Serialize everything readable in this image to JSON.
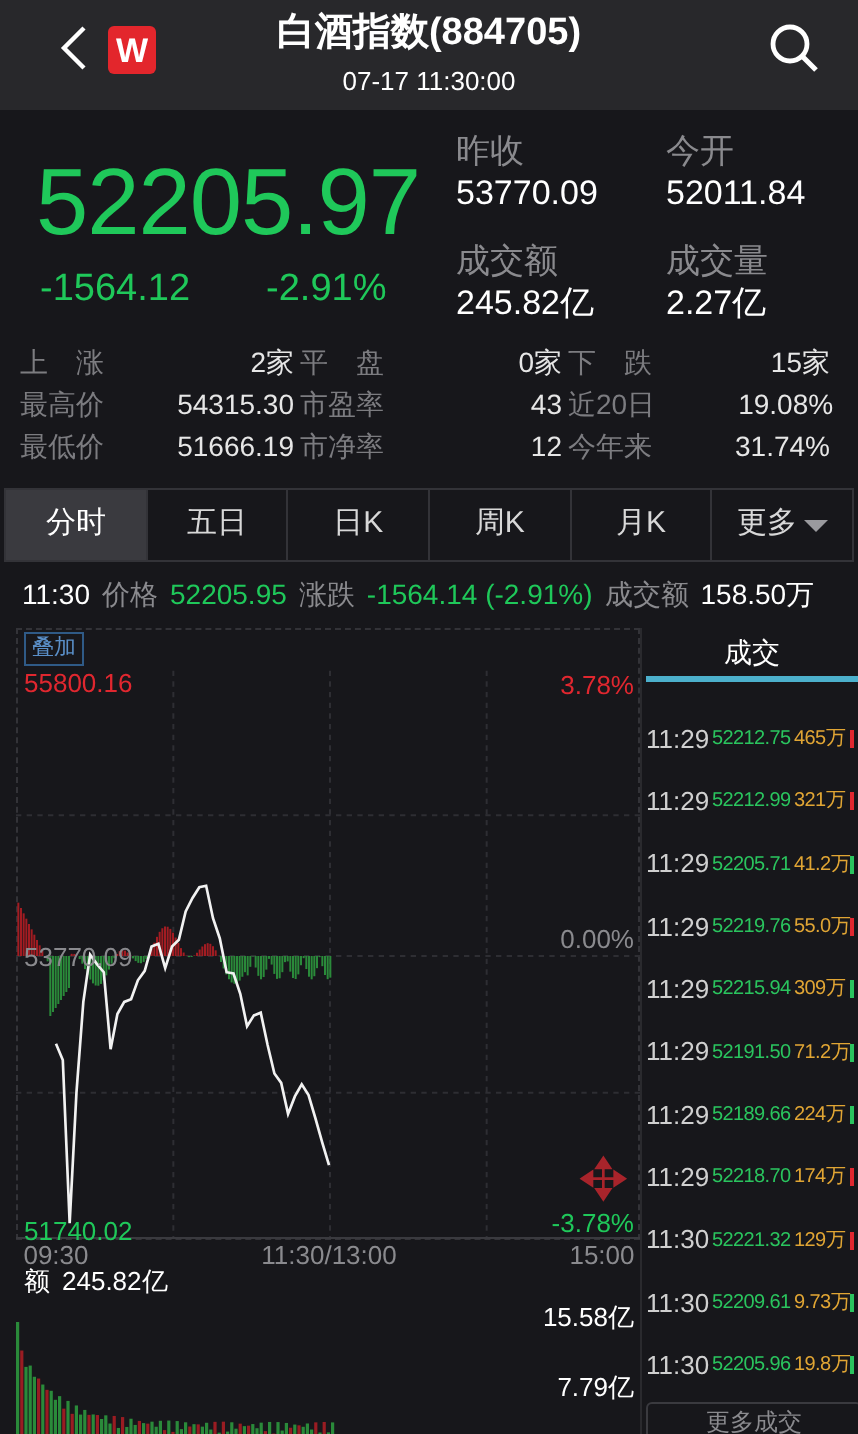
{
  "header": {
    "title": "白酒指数(884705)",
    "datetime": "07-17 11:30:00",
    "logo": "W"
  },
  "quote": {
    "price": "52205.97",
    "change": "-1564.12",
    "change_pct": "-2.91%"
  },
  "stats": [
    {
      "label": "昨收",
      "value": "53770.09"
    },
    {
      "label": "今开",
      "value": "52011.84"
    },
    {
      "label": "成交额",
      "value": "245.82亿"
    },
    {
      "label": "成交量",
      "value": "2.27亿"
    }
  ],
  "summary_rows": [
    [
      {
        "label": "上　涨",
        "value": "2家"
      },
      {
        "label": "平　盘",
        "value": "0家"
      },
      {
        "label": "下　跌",
        "value": "15家"
      }
    ],
    [
      {
        "label": "最高价",
        "value": "54315.30"
      },
      {
        "label": "市盈率",
        "value": "43"
      },
      {
        "label": "近20日",
        "value": "19.08%"
      }
    ],
    [
      {
        "label": "最低价",
        "value": "51666.19"
      },
      {
        "label": "市净率",
        "value": "12"
      },
      {
        "label": "今年来",
        "value": "31.74%"
      }
    ]
  ],
  "tabs": [
    {
      "label": "分时",
      "selected": true,
      "kind": "tab"
    },
    {
      "label": "五日",
      "selected": false,
      "kind": "tab"
    },
    {
      "label": "日K",
      "selected": false,
      "kind": "tab"
    },
    {
      "label": "周K",
      "selected": false,
      "kind": "tab"
    },
    {
      "label": "月K",
      "selected": false,
      "kind": "tab"
    },
    {
      "label": "更多",
      "selected": false,
      "kind": "dropdown"
    }
  ],
  "info_line": {
    "time": "11:30",
    "price_label": "价格",
    "price": "52205.95",
    "change_label": "涨跌",
    "change": "-1564.14 (-2.91%)",
    "amount_label": "成交额",
    "amount": "158.50万"
  },
  "chart": {
    "overlay_button": "叠加",
    "high_pct": "3.78%",
    "zero_pct": "0.00%",
    "low_pct": "-3.78%",
    "chart_data": {
      "type": "line",
      "ylim": [
        51740.02,
        55800.16
      ],
      "categories": [
        "09:30",
        null,
        null,
        null,
        null,
        null,
        null,
        null,
        null,
        null,
        null,
        null,
        null,
        null,
        null,
        null,
        null,
        null,
        null,
        null,
        null,
        null,
        null,
        null,
        null,
        null,
        null,
        null,
        null,
        null,
        null,
        null,
        null,
        null,
        null,
        null,
        null,
        null,
        null,
        null,
        "11:30/13:00",
        null,
        null,
        null,
        null,
        null,
        null,
        null,
        null,
        null,
        null,
        null,
        null,
        null,
        null,
        null,
        null,
        null,
        null,
        null,
        null,
        null,
        null,
        null,
        null,
        null,
        null,
        null,
        null,
        null,
        null,
        null,
        null,
        null,
        null,
        null,
        null,
        null,
        null,
        null,
        "15:00"
      ],
      "yticks": [
        {
          "value": 55800.16,
          "label": "55800.16"
        },
        {
          "value": 53770.09,
          "label": "53770.09"
        },
        {
          "value": 51740.02,
          "label": "51740.02"
        }
      ],
      "series": [
        {
          "color": "#f2f2f2",
          "values": [
            53120,
            53000,
            51790,
            52760,
            53430,
            53780,
            53710,
            53650,
            53080,
            53340,
            53430,
            53450,
            53590,
            53660,
            53840,
            53860,
            53680,
            53840,
            53890,
            54100,
            54200,
            54280,
            54290,
            54050,
            53900,
            53650,
            53640,
            53490,
            53250,
            53330,
            53350,
            53110,
            52900,
            52830,
            52600,
            52730,
            52820,
            52740,
            52570,
            52390,
            52220,
            null,
            null,
            null,
            null,
            null,
            null,
            null,
            null,
            null,
            null,
            null,
            null,
            null,
            null,
            null,
            null,
            null,
            null,
            null,
            null,
            null,
            null,
            null,
            null,
            null,
            null,
            null,
            null,
            null,
            null,
            null,
            null,
            null,
            null,
            null,
            null,
            null,
            null,
            null,
            null
          ]
        }
      ]
    }
  },
  "volume": {
    "label": "额",
    "total": "245.82亿",
    "scale_high": "15.58亿",
    "scale_mid": "7.79亿"
  },
  "trades": {
    "title": "成交",
    "rows": [
      {
        "time": "11:29",
        "price": "52212.75",
        "volume": "465万",
        "color": "#e0272f"
      },
      {
        "time": "11:29",
        "price": "52212.99",
        "volume": "321万",
        "color": "#e0272f"
      },
      {
        "time": "11:29",
        "price": "52205.71",
        "volume": "41.2万",
        "color": "#2ac45e"
      },
      {
        "time": "11:29",
        "price": "52219.76",
        "volume": "55.0万",
        "color": "#e0272f"
      },
      {
        "time": "11:29",
        "price": "52215.94",
        "volume": "309万",
        "color": "#2ac45e"
      },
      {
        "time": "11:29",
        "price": "52191.50",
        "volume": "71.2万",
        "color": "#2ac45e"
      },
      {
        "time": "11:29",
        "price": "52189.66",
        "volume": "224万",
        "color": "#2ac45e"
      },
      {
        "time": "11:29",
        "price": "52218.70",
        "volume": "174万",
        "color": "#e0272f"
      },
      {
        "time": "11:30",
        "price": "52221.32",
        "volume": "129万",
        "color": "#e0272f"
      },
      {
        "time": "11:30",
        "price": "52209.61",
        "volume": "9.73万",
        "color": "#2ac45e"
      },
      {
        "time": "11:30",
        "price": "52205.96",
        "volume": "19.8万",
        "color": "#2ac45e"
      }
    ],
    "more_button": "更多成交"
  }
}
